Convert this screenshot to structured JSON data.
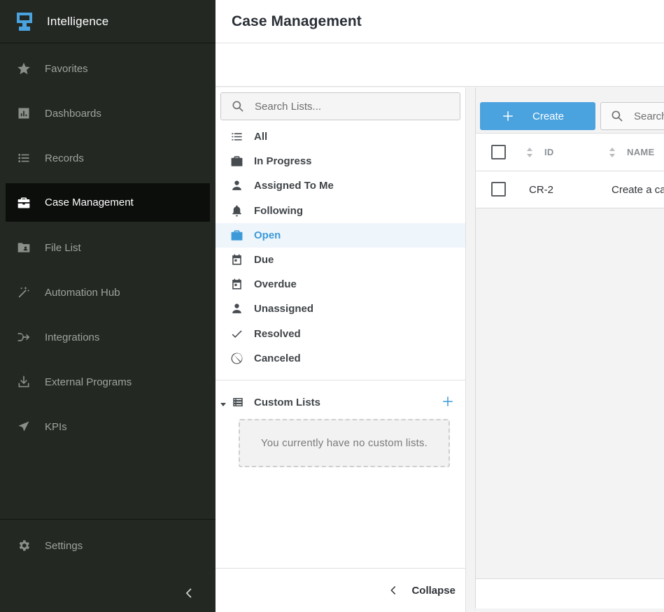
{
  "brand": {
    "name": "Intelligence"
  },
  "sidebar": {
    "items": [
      {
        "label": "Favorites",
        "icon": "star-icon"
      },
      {
        "label": "Dashboards",
        "icon": "chart-icon"
      },
      {
        "label": "Records",
        "icon": "list-icon"
      },
      {
        "label": "Case Management",
        "icon": "briefcase-icon",
        "active": true
      },
      {
        "label": "File List",
        "icon": "folder-user-icon"
      },
      {
        "label": "Automation Hub",
        "icon": "magic-wand-icon"
      },
      {
        "label": "Integrations",
        "icon": "merge-arrow-icon"
      },
      {
        "label": "External Programs",
        "icon": "download-icon"
      },
      {
        "label": "KPIs",
        "icon": "paper-plane-icon"
      }
    ],
    "settings_label": "Settings"
  },
  "header": {
    "title": "Case Management"
  },
  "lists": {
    "search_placeholder": "Search Lists...",
    "filters": [
      {
        "label": "All",
        "icon": "list-icon"
      },
      {
        "label": "In Progress",
        "icon": "briefcase-icon"
      },
      {
        "label": "Assigned To Me",
        "icon": "person-icon"
      },
      {
        "label": "Following",
        "icon": "bell-icon"
      },
      {
        "label": "Open",
        "icon": "briefcase-icon",
        "selected": true
      },
      {
        "label": "Due",
        "icon": "calendar-icon"
      },
      {
        "label": "Overdue",
        "icon": "calendar-icon"
      },
      {
        "label": "Unassigned",
        "icon": "person-icon"
      },
      {
        "label": "Resolved",
        "icon": "check-icon"
      },
      {
        "label": "Canceled",
        "icon": "ban-icon"
      }
    ],
    "custom_title": "Custom Lists",
    "empty_text": "You currently have no custom lists.",
    "collapse_label": "Collapse"
  },
  "table": {
    "create_label": "Create",
    "search_placeholder": "Search",
    "columns": [
      "ID",
      "NAME"
    ],
    "rows": [
      {
        "id": "CR-2",
        "name": "Create a ca"
      }
    ]
  },
  "colors": {
    "sidebar_bg": "#232823",
    "accent": "#4aa3df",
    "selected_text": "#3d9ad9"
  }
}
